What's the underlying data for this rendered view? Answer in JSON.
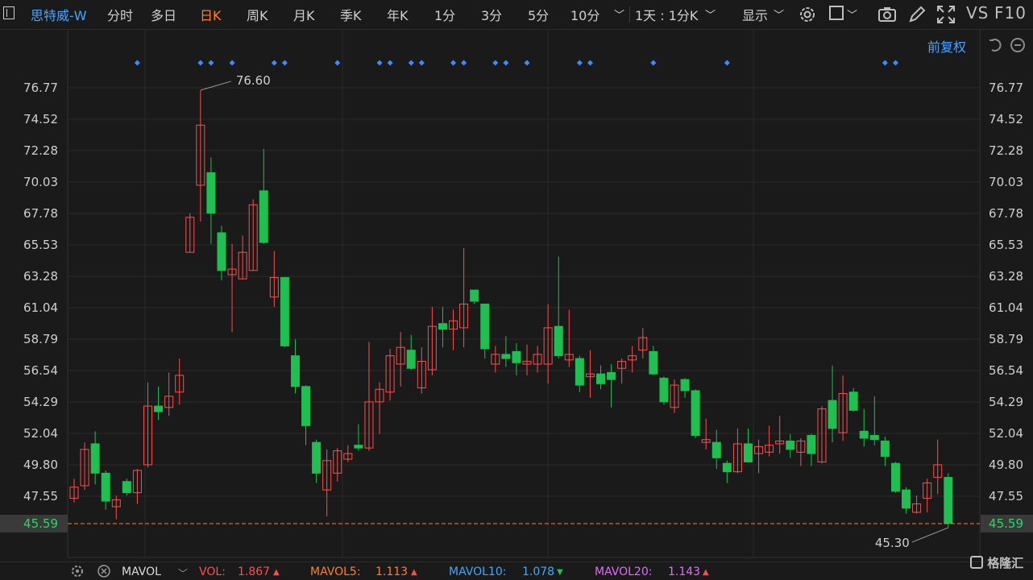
{
  "toolbar": {
    "stock_name": "思特威-W",
    "tabs": [
      {
        "label": "分时",
        "active": false
      },
      {
        "label": "多日",
        "active": false
      },
      {
        "label": "日K",
        "active": true
      },
      {
        "label": "周K",
        "active": false
      },
      {
        "label": "月K",
        "active": false
      },
      {
        "label": "季K",
        "active": false
      },
      {
        "label": "年K",
        "active": false
      },
      {
        "label": "1分",
        "active": false
      },
      {
        "label": "3分",
        "active": false
      },
      {
        "label": "5分",
        "active": false
      },
      {
        "label": "10分",
        "active": false
      }
    ],
    "period_select": "1天 : 1分K",
    "display_label": "显示",
    "vs_label": "VS",
    "f10_label": "F10"
  },
  "chart_header": {
    "adjust_label": "前复权"
  },
  "chart_data": {
    "type": "candlestick",
    "y_ticks": [
      "76.77",
      "74.52",
      "72.28",
      "70.03",
      "67.78",
      "65.53",
      "63.28",
      "61.04",
      "58.79",
      "56.54",
      "54.29",
      "52.04",
      "49.80",
      "47.55"
    ],
    "ylim": [
      45.0,
      77.9
    ],
    "current_price": "45.59",
    "max_annotation": "76.60",
    "min_annotation": "45.30",
    "colors": {
      "up": "#ff4d4d",
      "down": "#1fbf52",
      "grid": "#2a2a2a",
      "price_line": "#ff7f2a",
      "event_marker": "#3d8bfd"
    },
    "event_marker_candles": [
      6,
      12,
      13,
      15,
      19,
      20,
      25,
      29,
      30,
      32,
      33,
      36,
      37,
      40,
      41,
      43,
      48,
      49,
      55,
      62,
      77,
      78
    ],
    "candles": [
      {
        "o": 47.4,
        "h": 48.8,
        "l": 47.1,
        "c": 48.2
      },
      {
        "o": 48.3,
        "h": 51.4,
        "l": 48.0,
        "c": 50.9
      },
      {
        "o": 51.3,
        "h": 52.2,
        "l": 48.4,
        "c": 49.2
      },
      {
        "o": 49.2,
        "h": 49.4,
        "l": 46.6,
        "c": 47.2
      },
      {
        "o": 46.8,
        "h": 47.6,
        "l": 45.9,
        "c": 47.3
      },
      {
        "o": 48.6,
        "h": 48.8,
        "l": 47.6,
        "c": 47.8
      },
      {
        "o": 47.8,
        "h": 49.5,
        "l": 47.0,
        "c": 49.4
      },
      {
        "o": 49.8,
        "h": 55.7,
        "l": 49.6,
        "c": 54.0
      },
      {
        "o": 54.0,
        "h": 55.4,
        "l": 53.0,
        "c": 53.6
      },
      {
        "o": 53.9,
        "h": 56.4,
        "l": 53.3,
        "c": 54.7
      },
      {
        "o": 55.0,
        "h": 57.4,
        "l": 54.1,
        "c": 56.2
      },
      {
        "o": 65.0,
        "h": 67.8,
        "l": 65.0,
        "c": 67.5
      },
      {
        "o": 69.8,
        "h": 76.6,
        "l": 67.2,
        "c": 74.1
      },
      {
        "o": 70.7,
        "h": 71.8,
        "l": 65.6,
        "c": 67.8
      },
      {
        "o": 66.4,
        "h": 66.9,
        "l": 63.0,
        "c": 63.7
      },
      {
        "o": 63.4,
        "h": 65.6,
        "l": 59.3,
        "c": 63.8
      },
      {
        "o": 63.1,
        "h": 66.2,
        "l": 63.1,
        "c": 65.0
      },
      {
        "o": 63.7,
        "h": 68.8,
        "l": 63.7,
        "c": 68.4
      },
      {
        "o": 69.4,
        "h": 72.4,
        "l": 65.6,
        "c": 65.7
      },
      {
        "o": 61.8,
        "h": 65.1,
        "l": 61.1,
        "c": 63.2
      },
      {
        "o": 63.2,
        "h": 63.2,
        "l": 58.2,
        "c": 58.3
      },
      {
        "o": 57.6,
        "h": 58.8,
        "l": 54.9,
        "c": 55.4
      },
      {
        "o": 55.4,
        "h": 55.5,
        "l": 51.2,
        "c": 52.6
      },
      {
        "o": 51.4,
        "h": 51.6,
        "l": 48.5,
        "c": 49.2
      },
      {
        "o": 48.0,
        "h": 50.9,
        "l": 46.1,
        "c": 50.1
      },
      {
        "o": 49.2,
        "h": 51.0,
        "l": 48.6,
        "c": 50.8
      },
      {
        "o": 50.2,
        "h": 51.2,
        "l": 50.0,
        "c": 50.6
      },
      {
        "o": 51.2,
        "h": 52.7,
        "l": 50.8,
        "c": 51.0
      },
      {
        "o": 51.0,
        "h": 58.6,
        "l": 50.8,
        "c": 54.3
      },
      {
        "o": 54.3,
        "h": 55.7,
        "l": 52.0,
        "c": 55.2
      },
      {
        "o": 55.0,
        "h": 58.1,
        "l": 54.4,
        "c": 57.6
      },
      {
        "o": 57.0,
        "h": 59.3,
        "l": 55.4,
        "c": 58.2
      },
      {
        "o": 58.0,
        "h": 59.1,
        "l": 56.6,
        "c": 56.7
      },
      {
        "o": 55.3,
        "h": 58.2,
        "l": 54.9,
        "c": 57.2
      },
      {
        "o": 56.6,
        "h": 61.1,
        "l": 56.2,
        "c": 59.7
      },
      {
        "o": 59.9,
        "h": 61.1,
        "l": 58.2,
        "c": 59.5
      },
      {
        "o": 59.5,
        "h": 60.9,
        "l": 58.0,
        "c": 60.1
      },
      {
        "o": 59.6,
        "h": 65.3,
        "l": 58.2,
        "c": 61.3
      },
      {
        "o": 62.3,
        "h": 62.3,
        "l": 61.3,
        "c": 61.5
      },
      {
        "o": 61.3,
        "h": 61.3,
        "l": 57.4,
        "c": 58.1
      },
      {
        "o": 57.0,
        "h": 58.3,
        "l": 56.4,
        "c": 57.7
      },
      {
        "o": 57.7,
        "h": 59.0,
        "l": 56.8,
        "c": 57.4
      },
      {
        "o": 57.9,
        "h": 58.5,
        "l": 56.2,
        "c": 57.1
      },
      {
        "o": 57.0,
        "h": 58.4,
        "l": 56.2,
        "c": 57.2
      },
      {
        "o": 57.0,
        "h": 58.3,
        "l": 56.4,
        "c": 57.7
      },
      {
        "o": 57.0,
        "h": 61.3,
        "l": 55.6,
        "c": 59.6
      },
      {
        "o": 59.7,
        "h": 64.7,
        "l": 57.4,
        "c": 57.6
      },
      {
        "o": 57.3,
        "h": 60.9,
        "l": 56.8,
        "c": 57.7
      },
      {
        "o": 57.4,
        "h": 57.6,
        "l": 55.0,
        "c": 55.5
      },
      {
        "o": 56.1,
        "h": 58.0,
        "l": 54.6,
        "c": 56.3
      },
      {
        "o": 56.3,
        "h": 56.9,
        "l": 55.2,
        "c": 55.6
      },
      {
        "o": 56.4,
        "h": 57.0,
        "l": 53.9,
        "c": 55.9
      },
      {
        "o": 56.7,
        "h": 57.4,
        "l": 55.6,
        "c": 57.2
      },
      {
        "o": 57.3,
        "h": 58.3,
        "l": 56.4,
        "c": 57.6
      },
      {
        "o": 58.0,
        "h": 59.6,
        "l": 57.4,
        "c": 58.9
      },
      {
        "o": 57.9,
        "h": 58.3,
        "l": 56.2,
        "c": 56.3
      },
      {
        "o": 56.0,
        "h": 56.1,
        "l": 54.1,
        "c": 54.3
      },
      {
        "o": 53.9,
        "h": 55.9,
        "l": 53.5,
        "c": 55.5
      },
      {
        "o": 55.9,
        "h": 56.0,
        "l": 54.6,
        "c": 55.1
      },
      {
        "o": 55.1,
        "h": 55.2,
        "l": 51.7,
        "c": 51.9
      },
      {
        "o": 51.4,
        "h": 53.1,
        "l": 50.9,
        "c": 51.6
      },
      {
        "o": 51.4,
        "h": 52.3,
        "l": 49.5,
        "c": 50.3
      },
      {
        "o": 49.9,
        "h": 50.1,
        "l": 48.5,
        "c": 49.3
      },
      {
        "o": 49.3,
        "h": 52.4,
        "l": 49.2,
        "c": 51.3
      },
      {
        "o": 51.3,
        "h": 52.4,
        "l": 50.6,
        "c": 50.0
      },
      {
        "o": 50.6,
        "h": 51.6,
        "l": 49.2,
        "c": 51.1
      },
      {
        "o": 50.7,
        "h": 52.6,
        "l": 50.4,
        "c": 51.2
      },
      {
        "o": 51.3,
        "h": 53.3,
        "l": 50.6,
        "c": 51.5
      },
      {
        "o": 51.5,
        "h": 52.0,
        "l": 50.3,
        "c": 50.9
      },
      {
        "o": 50.7,
        "h": 51.7,
        "l": 49.7,
        "c": 51.5
      },
      {
        "o": 51.9,
        "h": 52.0,
        "l": 49.7,
        "c": 50.6
      },
      {
        "o": 50.0,
        "h": 54.0,
        "l": 49.9,
        "c": 53.8
      },
      {
        "o": 54.4,
        "h": 56.9,
        "l": 51.4,
        "c": 52.4
      },
      {
        "o": 52.1,
        "h": 56.2,
        "l": 51.5,
        "c": 54.9
      },
      {
        "o": 55.0,
        "h": 55.3,
        "l": 53.6,
        "c": 53.7
      },
      {
        "o": 52.2,
        "h": 53.8,
        "l": 51.1,
        "c": 51.7
      },
      {
        "o": 51.9,
        "h": 54.7,
        "l": 51.2,
        "c": 51.6
      },
      {
        "o": 51.5,
        "h": 51.8,
        "l": 49.7,
        "c": 50.4
      },
      {
        "o": 49.9,
        "h": 50.0,
        "l": 47.8,
        "c": 47.9
      },
      {
        "o": 48.0,
        "h": 48.2,
        "l": 46.3,
        "c": 46.7
      },
      {
        "o": 46.4,
        "h": 47.6,
        "l": 46.3,
        "c": 47.0
      },
      {
        "o": 47.4,
        "h": 48.8,
        "l": 46.4,
        "c": 48.5
      },
      {
        "o": 48.9,
        "h": 51.6,
        "l": 47.7,
        "c": 49.8
      },
      {
        "o": 48.9,
        "h": 49.2,
        "l": 45.3,
        "c": 45.6
      }
    ]
  },
  "bottombar": {
    "indicator_name": "MAVOL",
    "vol_label": "VOL:",
    "vol_value": "1.867",
    "mavol5_label": "MAVOL5:",
    "mavol5_value": "1.113",
    "mavol10_label": "MAVOL10:",
    "mavol10_value": "1.078",
    "mavol20_label": "MAVOL20:",
    "mavol20_value": "1.143"
  },
  "watermark": "格隆汇"
}
